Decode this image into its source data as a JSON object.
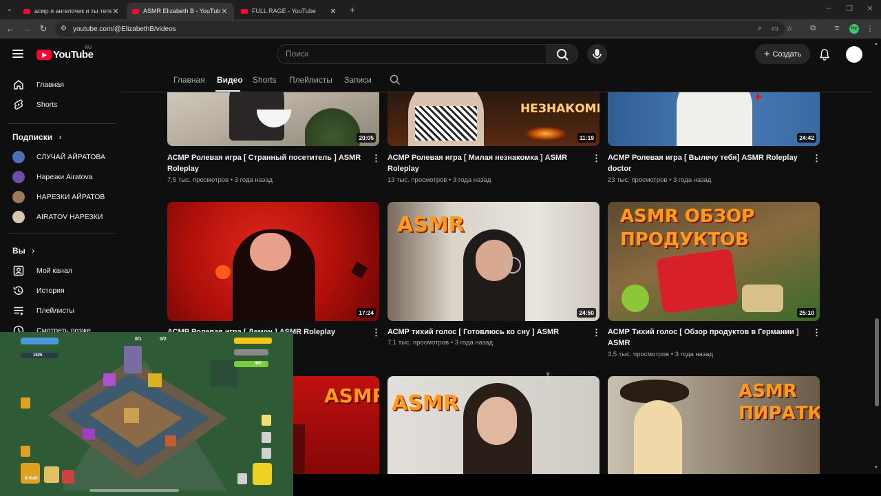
{
  "browser": {
    "tabs": [
      {
        "title": "асмр я ангелочек и ты тепер",
        "active": false
      },
      {
        "title": "ASMR Elizabeth B - YouTube",
        "active": true
      },
      {
        "title": "FULL RAGE - YouTube",
        "active": false
      }
    ],
    "url": "youtube.com/@ElizabethB/videos",
    "profile_initials": "He"
  },
  "header": {
    "logo_text": "YouTube",
    "region": "RU",
    "search_placeholder": "Поиск",
    "create_label": "Создать"
  },
  "sidebar": {
    "main": [
      {
        "label": "Главная",
        "icon": "home-icon"
      },
      {
        "label": "Shorts",
        "icon": "shorts-icon"
      }
    ],
    "subscriptions_heading": "Подписки",
    "subscriptions": [
      {
        "label": "СЛУЧАЙ АЙРАТОВА",
        "color": "#4a6fb5"
      },
      {
        "label": "Нарезки Airatova",
        "color": "#6b4fa8"
      },
      {
        "label": "НАРЕЗКИ АЙРАТОВ",
        "color": "#9a7a5a"
      },
      {
        "label": "AIRATOV НАРЕЗКИ",
        "color": "#d8c8b0"
      }
    ],
    "you_heading": "Вы",
    "you_items": [
      {
        "label": "Мой канал",
        "icon": "my-channel-icon"
      },
      {
        "label": "История",
        "icon": "history-icon"
      },
      {
        "label": "Плейлисты",
        "icon": "playlists-icon"
      },
      {
        "label": "Смотреть позже",
        "icon": "watch-later-icon"
      }
    ]
  },
  "channel_tabs": [
    {
      "label": "Главная",
      "active": false
    },
    {
      "label": "Видео",
      "active": true
    },
    {
      "label": "Shorts",
      "active": false
    },
    {
      "label": "Плейлисты",
      "active": false
    },
    {
      "label": "Записи",
      "active": false
    }
  ],
  "videos": [
    {
      "title": "АСМР Ролевая игра [ Странный посетитель ] ASMR Roleplay",
      "meta": "7,5 тыс. просмотров • 3 года назад",
      "duration": "20:05",
      "overlay": "",
      "thumb_color": "#c9c2b8"
    },
    {
      "title": "АСМР Ролевая игра [ Милая незнакомка ] ASMR Roleplay",
      "meta": "13 тыс. просмотров • 3 года назад",
      "duration": "11:19",
      "overlay": "НЕЗНАКОМКА",
      "thumb_color": "#3a2418"
    },
    {
      "title": "АСМР Ролевая игра [ Вылечу тебя] ASMR Roleplay doctor",
      "meta": "23 тыс. просмотров • 3 года назад",
      "duration": "24:42",
      "overlay": "",
      "thumb_color": "#3f6fa8"
    },
    {
      "title": "АСМР Ролевая игра [ Демон ] ASMR Roleplay",
      "meta": "",
      "duration": "17:24",
      "overlay": "",
      "thumb_color": "#c01812"
    },
    {
      "title": "АСМР тихий голос [ Готовлюсь ко сну ] ASMR",
      "meta": "7,1 тыс. просмотров • 3 года назад",
      "duration": "24:50",
      "overlay": "ASMR",
      "thumb_color": "#d9d4cc"
    },
    {
      "title": "АСМР Тихий голос [ Обзор продуктов в Германии ] ASMR",
      "meta": "3,5 тыс. просмотров • 3 года назад",
      "duration": "25:10",
      "overlay": "ASMR ОБЗОР ПРОДУКТОВ",
      "thumb_color": "#6b5a3a"
    },
    {
      "title": "",
      "meta": "",
      "duration": "",
      "overlay": "ASMR",
      "thumb_color": "#b01010"
    },
    {
      "title": "",
      "meta": "",
      "duration": "",
      "overlay": "ASMR",
      "thumb_color": "#d8d4d0"
    },
    {
      "title": "",
      "meta": "",
      "duration": "",
      "overlay": "ASMR ПИРАТКА",
      "thumb_color": "#a49a8a"
    }
  ],
  "game_overlay": {
    "counter_troops": "0/1",
    "counter_stars": "0/2",
    "resource_gold": "1525",
    "resource_elixir": "400",
    "battle_label": "В бой!"
  }
}
